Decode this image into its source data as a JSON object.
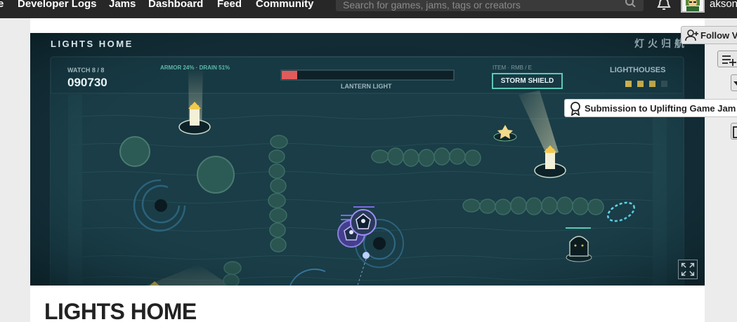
{
  "nav": {
    "items": [
      "e",
      "Developer Logs",
      "Jams",
      "Dashboard",
      "Feed",
      "Community"
    ],
    "search_placeholder": "Search for games, jams, tags or creators",
    "username": "akson"
  },
  "game": {
    "title": "LIGHTS HOME",
    "cjk_title": "灯火归航",
    "watch_label": "WATCH 8 / 8",
    "score": "090730",
    "status_text": "ARMOR 24% · DRAIN 51%",
    "lantern_label": "LANTERN LIGHT",
    "lantern_level": 0.09,
    "item_label": "ITEM · RMB / E",
    "item_value": "STORM SHIELD",
    "lighthouses_label": "LIGHTHOUSES",
    "lighthouses_lit": 3,
    "lighthouses_total": 4,
    "colors": {
      "background": "#15303a",
      "accent": "#5fc8b6",
      "lantern": "#f2c94c",
      "health": "#e05b5b"
    }
  },
  "sidebar": {
    "follow_label": "Follow V",
    "badge_label": "Submission to Uplifting Game Jam -"
  },
  "page": {
    "title": "LIGHTS HOME"
  }
}
